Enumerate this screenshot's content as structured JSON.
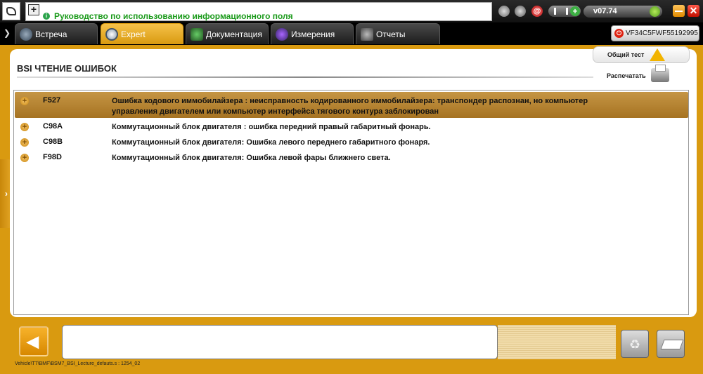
{
  "topbar": {
    "info_text": "Руководство по использованию информационного поля",
    "info_dot": "i",
    "plus_label": "+",
    "version": "v07.74",
    "at_symbol": "@"
  },
  "tabs": [
    {
      "label": "Встреча",
      "active": false
    },
    {
      "label": "Expert",
      "active": true
    },
    {
      "label": "Документация",
      "active": false
    },
    {
      "label": "Измерения",
      "active": false
    },
    {
      "label": "Отчеты",
      "active": false
    }
  ],
  "vin": "VF34C5FWF55192995",
  "page": {
    "title": "BSI ЧТЕНИЕ ОШИБОК"
  },
  "tools": {
    "general_test": "Общий тест",
    "print": "Распечатать"
  },
  "faults": [
    {
      "code": "F527",
      "description": "Ошибка кодового иммобилайзера : неисправность кодированного иммобилайзера: транспондер распознан, но компьютер управления двигателем или компьютер интерфейса тягового контура заблокирован",
      "selected": true
    },
    {
      "code": "C98A",
      "description": "Коммутационный блок двигателя : ошибка передний правый габаритный фонарь.",
      "selected": false
    },
    {
      "code": "C98B",
      "description": "Коммутационный блок двигателя: Ошибка левого переднего габаритного фонаря.",
      "selected": false
    },
    {
      "code": "F98D",
      "description": "Коммутационный блок двигателя: Ошибка левой фары ближнего света.",
      "selected": false
    }
  ],
  "footer": {
    "path": "Vehicle\\T7\\BMF\\BSM7_BSI_Lecture_defauts.s : 1254_02"
  },
  "colors": {
    "accent": "#d99a10",
    "selected_row": "#b3832f",
    "info_text": "#1a9a1a"
  }
}
